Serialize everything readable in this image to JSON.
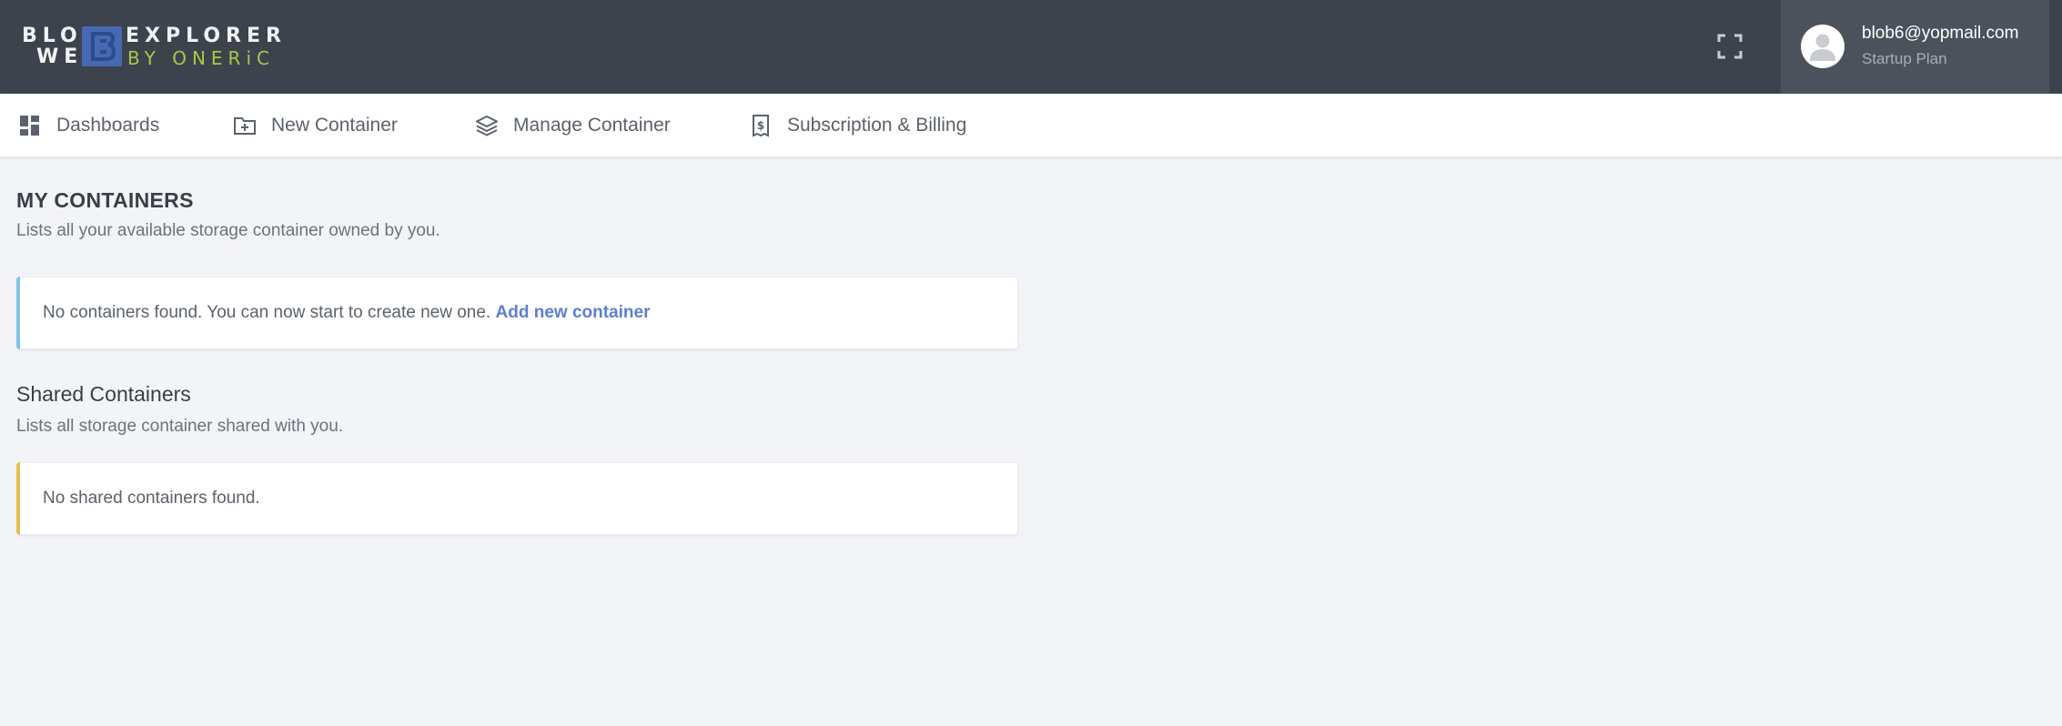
{
  "brand": {
    "line1_left": "BLO",
    "line2_left": "WE",
    "line1_right": "EXPLORER",
    "line2_right": "BY ONERiC",
    "accent_color": "#4669b3",
    "tagline_color": "#a6c84a"
  },
  "header": {
    "fullscreen_icon": "fullscreen-icon",
    "user": {
      "email": "blob6@yopmail.com",
      "plan": "Startup Plan",
      "avatar_icon": "user-avatar-icon"
    }
  },
  "nav": {
    "items": [
      {
        "label": "Dashboards",
        "icon": "dashboard-grid-icon"
      },
      {
        "label": "New Container",
        "icon": "folder-plus-icon"
      },
      {
        "label": "Manage Container",
        "icon": "layers-icon"
      },
      {
        "label": "Subscription & Billing",
        "icon": "receipt-dollar-icon"
      }
    ]
  },
  "my_containers": {
    "title": "MY CONTAINERS",
    "subtitle": "Lists all your available storage container owned by you.",
    "empty_message": "No containers found. You can now start to create new one.",
    "link_label": "Add new container",
    "accent_color": "#7fc3e8"
  },
  "shared_containers": {
    "title": "Shared Containers",
    "subtitle": "Lists all storage container shared with you.",
    "empty_message": "No shared containers found.",
    "accent_color": "#e8c04f"
  }
}
